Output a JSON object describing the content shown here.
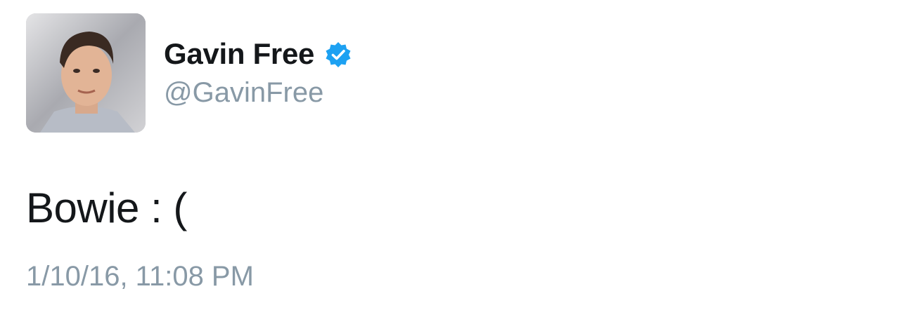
{
  "tweet": {
    "author": {
      "display_name": "Gavin Free",
      "handle": "@GavinFree",
      "verified": true
    },
    "text": "Bowie : (",
    "timestamp": "1/10/16, 11:08 PM"
  },
  "icons": {
    "avatar": "profile-photo",
    "verified": "verified-badge-icon"
  },
  "colors": {
    "name": "#14171a",
    "muted": "#8899a6",
    "verified_blue": "#1da1f2"
  }
}
